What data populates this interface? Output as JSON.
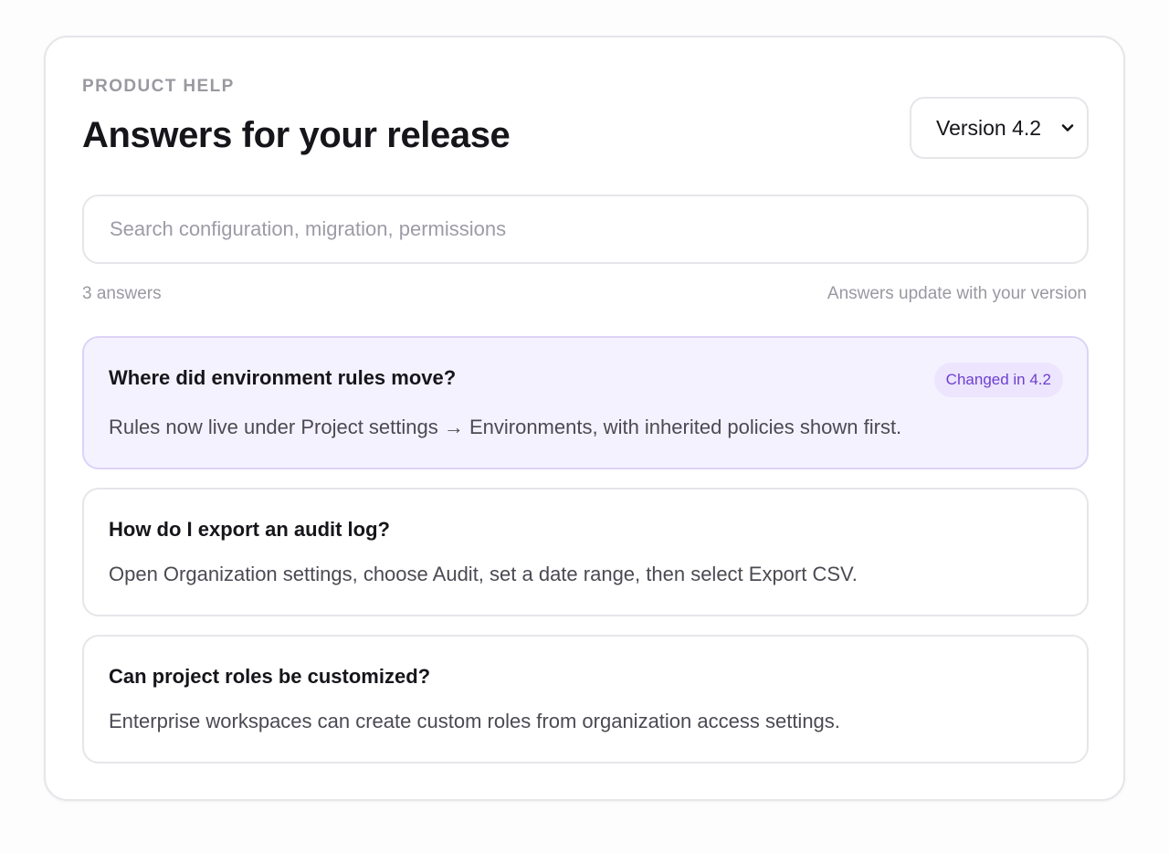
{
  "header": {
    "eyebrow": "PRODUCT HELP",
    "title": "Answers for your release"
  },
  "version_select": {
    "selected": "Version 4.2",
    "icon": "chevron-down-icon"
  },
  "search": {
    "placeholder": "Search configuration, migration, permissions",
    "value": ""
  },
  "meta": {
    "count": "3 answers",
    "note": "Answers update with your version"
  },
  "answers": [
    {
      "question": "Where did environment rules move?",
      "answer": "Rules now live under Project settings → Environments, with inherited policies shown first.",
      "badge": "Changed in 4.2"
    },
    {
      "question": "How do I export an audit log?",
      "answer": "Open Organization settings, choose Audit, set a date range, then select Export CSV."
    },
    {
      "question": "Can project roles be customized?",
      "answer": "Enterprise workspaces can create custom roles from organization access settings."
    }
  ],
  "colors": {
    "highlight_bg": "#f5f2ff",
    "highlight_border": "#dcd3f8",
    "badge_bg": "#ece5fd",
    "badge_text": "#6d3fd0",
    "muted_text": "#9a99a1"
  }
}
